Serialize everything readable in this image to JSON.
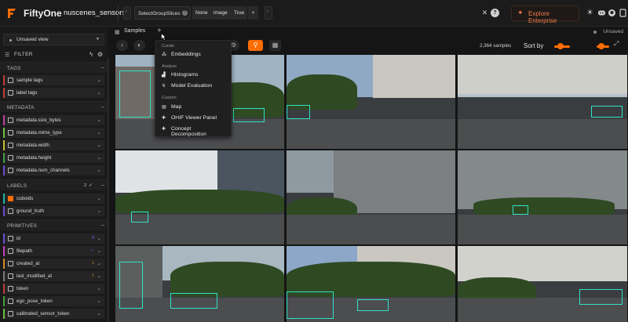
{
  "header": {
    "app_name": "FiftyOne",
    "dataset_name": "nuscenes_sensors",
    "operator": {
      "name": "SelectGroupSlices",
      "args": [
        "None",
        "image",
        "True"
      ]
    },
    "enterprise_label": "Explore Enterprise",
    "accent_color": "#ff6d04"
  },
  "sidebar": {
    "view_label": "Unsaved view",
    "filter_label": "FILTER",
    "sections": {
      "tags": {
        "title": "TAGS",
        "items": [
          {
            "label": "sample tags",
            "color": "#c23b3b"
          },
          {
            "label": "label tags",
            "color": "#c23b3b"
          }
        ]
      },
      "metadata": {
        "title": "METADATA",
        "items": [
          {
            "label": "metadata.size_bytes",
            "color": "#b8409a"
          },
          {
            "label": "metadata.mime_type",
            "color": "#6fbf3f"
          },
          {
            "label": "metadata.width",
            "color": "#c8c030"
          },
          {
            "label": "metadata.height",
            "color": "#3fa03f"
          },
          {
            "label": "metadata.num_channels",
            "color": "#6a4bd0"
          }
        ]
      },
      "labels": {
        "title": "LABELS",
        "count": "2",
        "items": [
          {
            "label": "cuboids",
            "color": "#1fb7a6",
            "checked": true
          },
          {
            "label": "ground_truth",
            "color": "#6a4bd0",
            "checked": false
          }
        ]
      },
      "primitives": {
        "title": "PRIMITIVES",
        "items": [
          {
            "label": "id",
            "color": "#6a4bd0",
            "badge": "0"
          },
          {
            "label": "filepath",
            "color": "#c040c0",
            "badge": "✓"
          },
          {
            "label": "created_at",
            "color": "#d08a2a",
            "badge": "1"
          },
          {
            "label": "last_modified_at",
            "color": "#7a7a7a",
            "badge": "1"
          },
          {
            "label": "token",
            "color": "#c23b3b",
            "badge": ""
          },
          {
            "label": "ego_pose_token",
            "color": "#3fa03f",
            "badge": ""
          },
          {
            "label": "calibrated_sensor_token",
            "color": "#6fbf3f",
            "badge": ""
          }
        ]
      }
    }
  },
  "main": {
    "tab_label": "Samples",
    "unsaved_label": "Unsaved",
    "sample_count": "2,364 samples",
    "sort_label": "Sort by"
  },
  "menu": {
    "groups": [
      {
        "title": "Curate",
        "items": [
          {
            "label": "Embeddings",
            "icon": "embeddings-icon"
          }
        ]
      },
      {
        "title": "Analyze",
        "items": [
          {
            "label": "Histograms",
            "icon": "histogram-icon"
          },
          {
            "label": "Model Evaluation",
            "icon": "evaluation-icon"
          }
        ]
      },
      {
        "title": "Custom",
        "items": [
          {
            "label": "Map",
            "icon": "map-icon"
          },
          {
            "label": "OHIF Viewer Panel",
            "icon": "plugin-icon"
          },
          {
            "label": "Concept Decomposition",
            "icon": "plugin-icon"
          }
        ]
      }
    ]
  }
}
